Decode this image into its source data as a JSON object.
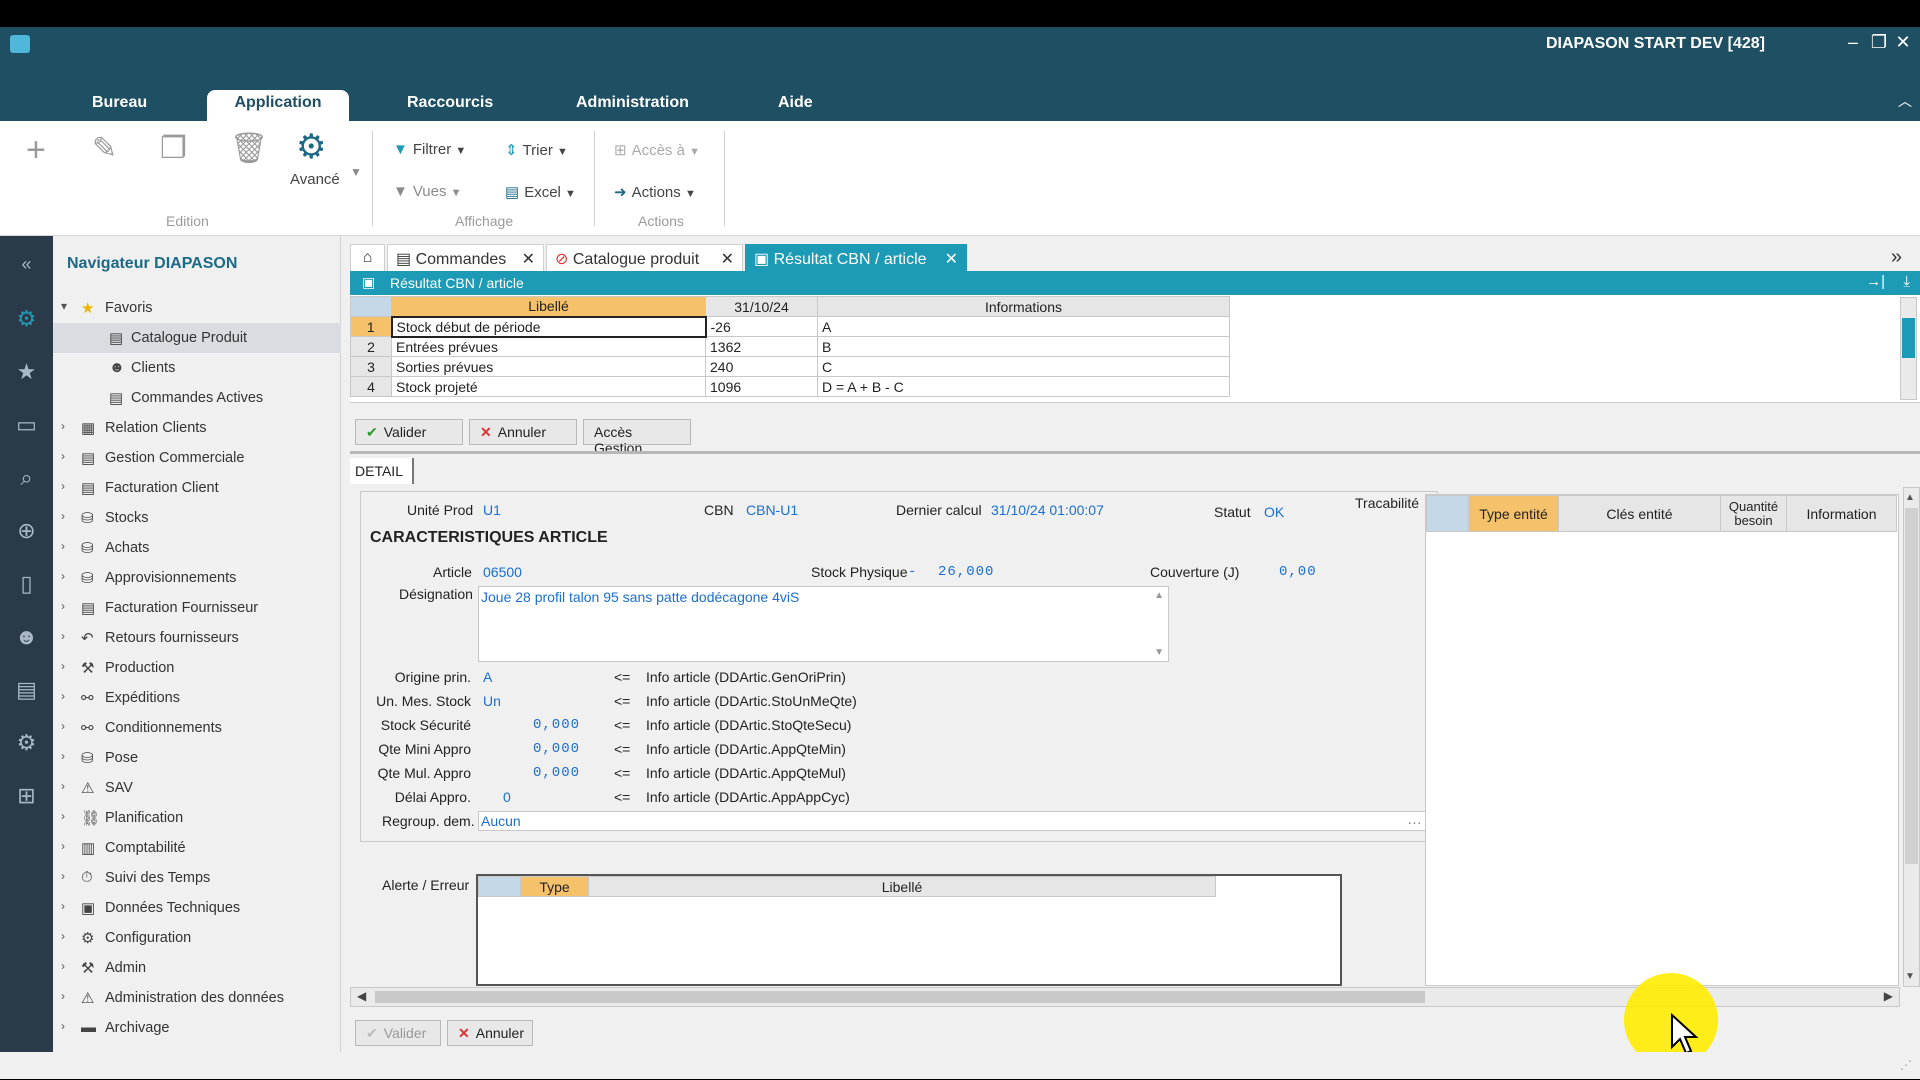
{
  "window": {
    "title": "DIAPASON START DEV [428]"
  },
  "menu": {
    "items": [
      "Bureau",
      "Application",
      "Raccourcis",
      "Administration",
      "Aide"
    ],
    "active": "Application"
  },
  "ribbon": {
    "avance": "Avancé",
    "filtrer": "Filtrer",
    "trier": "Trier",
    "acces": "Accès à",
    "vues": "Vues",
    "excel": "Excel",
    "actions": "Actions",
    "groups": {
      "edition": "Edition",
      "affichage": "Affichage",
      "actions": "Actions"
    }
  },
  "navigator": {
    "title": "Navigateur DIAPASON",
    "favoris": "Favoris",
    "favorites": [
      "Catalogue Produit",
      "Clients",
      "Commandes Actives"
    ],
    "items": [
      "Relation Clients",
      "Gestion Commerciale",
      "Facturation Client",
      "Stocks",
      "Achats",
      "Approvisionnements",
      "Facturation Fournisseur",
      "Retours fournisseurs",
      "Production",
      "Expéditions",
      "Conditionnements",
      "Pose",
      "SAV",
      "Planification",
      "Comptabilité",
      "Suivi des Temps",
      "Données Techniques",
      "Configuration",
      "Admin",
      "Administration des données",
      "Archivage"
    ]
  },
  "tabs": [
    "Commandes",
    "Catalogue produit",
    "Résultat CBN / article"
  ],
  "subheader": {
    "title": "Résultat CBN / article"
  },
  "grid": {
    "headers": [
      "Libellé",
      "31/10/24",
      "Informations"
    ],
    "rows": [
      {
        "n": "1",
        "libelle": "Stock début de période",
        "val": "-26",
        "info": "A"
      },
      {
        "n": "2",
        "libelle": "Entrées prévues",
        "val": "1362",
        "info": "B"
      },
      {
        "n": "3",
        "libelle": "Sorties prévues",
        "val": "240",
        "info": "C"
      },
      {
        "n": "4",
        "libelle": "Stock projeté",
        "val": "1096",
        "info": "D = A + B - C"
      }
    ]
  },
  "buttons": {
    "valider": "Valider",
    "annuler": "Annuler",
    "acces_gestion": "Accès Gestion"
  },
  "detail": {
    "tab": "DETAIL",
    "unite_prod_label": "Unité Prod",
    "unite_prod": "U1",
    "cbn_label": "CBN",
    "cbn": "CBN-U1",
    "dernier_calcul_label": "Dernier calcul",
    "dernier_calcul": "31/10/24 01:00:07",
    "statut_label": "Statut",
    "statut": "OK",
    "section_title": "CARACTERISTIQUES ARTICLE",
    "article_label": "Article",
    "article": "06500",
    "stock_physique_label": "Stock Physique",
    "stock_physique_sign": "-",
    "stock_physique": "26,000",
    "couverture_label": "Couverture (J)",
    "couverture": "0,00",
    "designation_label": "Désignation",
    "designation": "Joue 28 profil talon 95 sans patte dodécagone 4viS",
    "fields": [
      {
        "label": "Origine prin.",
        "value": "A",
        "info": "Info article (DDArtic.GenOriPrin)"
      },
      {
        "label": "Un. Mes. Stock",
        "value": "Un",
        "info": "Info article (DDArtic.StoUnMeQte)"
      },
      {
        "label": "Stock Sécurité",
        "value": "0,000",
        "info": "Info article (DDArtic.StoQteSecu)"
      },
      {
        "label": "Qte Mini Appro",
        "value": "0,000",
        "info": "Info article (DDArtic.AppQteMin)"
      },
      {
        "label": "Qte Mul. Appro",
        "value": "0,000",
        "info": "Info article (DDArtic.AppQteMul)"
      },
      {
        "label": "Délai Appro.",
        "value": "0",
        "info": "Info article (DDArtic.AppAppCyc)"
      }
    ],
    "arrow": "<=",
    "regroup_label": "Regroup. dem.",
    "regroup": "Aucun",
    "alerte_label": "Alerte / Erreur",
    "alerte_headers": [
      "Type",
      "Libellé"
    ],
    "tracabilite_label": "Tracabilité",
    "trace_headers": [
      "Type entité",
      "Clés entité",
      "Quantité besoin",
      "Information"
    ]
  }
}
